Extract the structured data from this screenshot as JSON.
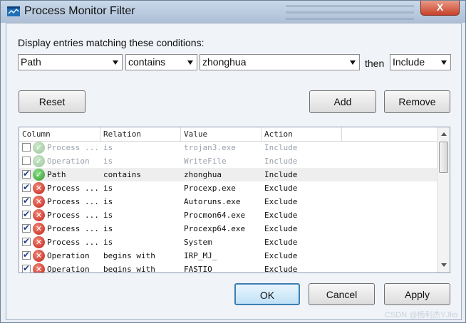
{
  "window": {
    "title": "Process Monitor Filter",
    "close_label": "X"
  },
  "filter": {
    "prompt": "Display entries matching these conditions:",
    "column_value": "Path",
    "relation_value": "contains",
    "value_text": "zhonghua",
    "then_label": "then",
    "action_value": "Include"
  },
  "buttons": {
    "reset": "Reset",
    "add": "Add",
    "remove": "Remove",
    "ok": "OK",
    "cancel": "Cancel",
    "apply": "Apply"
  },
  "table": {
    "headers": [
      "Column",
      "Relation",
      "Value",
      "Action"
    ],
    "rows": [
      {
        "column": "Process ...",
        "relation": "is",
        "value": "trojan3.exe",
        "action": "Include",
        "checked": false,
        "status": "ok",
        "dim": true
      },
      {
        "column": "Operation",
        "relation": "is",
        "value": "WriteFile",
        "action": "Include",
        "checked": false,
        "status": "ok",
        "dim": true
      },
      {
        "column": "Path",
        "relation": "contains",
        "value": "zhonghua",
        "action": "Include",
        "checked": true,
        "status": "ok",
        "dim": false,
        "selected": true
      },
      {
        "column": "Process ...",
        "relation": "is",
        "value": "Procexp.exe",
        "action": "Exclude",
        "checked": true,
        "status": "x",
        "dim": false
      },
      {
        "column": "Process ...",
        "relation": "is",
        "value": "Autoruns.exe",
        "action": "Exclude",
        "checked": true,
        "status": "x",
        "dim": false
      },
      {
        "column": "Process ...",
        "relation": "is",
        "value": "Procmon64.exe",
        "action": "Exclude",
        "checked": true,
        "status": "x",
        "dim": false
      },
      {
        "column": "Process ...",
        "relation": "is",
        "value": "Procexp64.exe",
        "action": "Exclude",
        "checked": true,
        "status": "x",
        "dim": false
      },
      {
        "column": "Process ...",
        "relation": "is",
        "value": "System",
        "action": "Exclude",
        "checked": true,
        "status": "x",
        "dim": false
      },
      {
        "column": "Operation",
        "relation": "begins with",
        "value": "IRP_MJ_",
        "action": "Exclude",
        "checked": true,
        "status": "x",
        "dim": false
      },
      {
        "column": "Operation",
        "relation": "begins with",
        "value": "FASTIO",
        "action": "Exclude",
        "checked": true,
        "status": "x",
        "dim": false
      }
    ]
  },
  "watermark": "CSDN @杨利杰YJlio",
  "colors": {
    "titlebar": "#b7c8dd",
    "close": "#c7422a",
    "include_icon": "#2e9b2e",
    "exclude_icon": "#c41f18",
    "ok_focus": "#3c7fb1"
  }
}
